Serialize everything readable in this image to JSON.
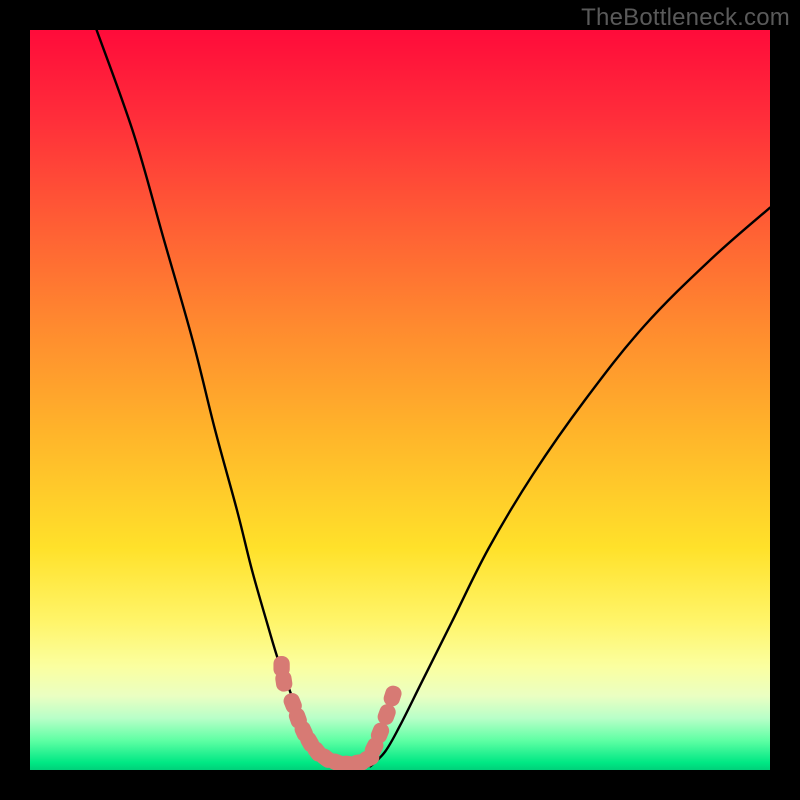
{
  "watermark": "TheBottleneck.com",
  "colors": {
    "frame": "#000000",
    "curve_stroke": "#000000",
    "marker_fill": "#d77a74",
    "marker_stroke": "#d77a74"
  },
  "chart_data": {
    "type": "line",
    "title": "",
    "xlabel": "",
    "ylabel": "",
    "xlim": [
      0,
      100
    ],
    "ylim": [
      0,
      100
    ],
    "grid": false,
    "legend": false,
    "series": [
      {
        "name": "left-curve",
        "x": [
          9,
          14,
          18,
          22,
          25,
          28,
          30,
          32,
          33.5,
          35,
          36.5,
          38,
          40,
          43
        ],
        "y": [
          100,
          86,
          72,
          58,
          46,
          35,
          27,
          20,
          15,
          11,
          7,
          4.5,
          2,
          0.5
        ]
      },
      {
        "name": "right-curve",
        "x": [
          46,
          48,
          50,
          53,
          57,
          62,
          68,
          75,
          83,
          92,
          100
        ],
        "y": [
          0.5,
          2.5,
          6,
          12,
          20,
          30,
          40,
          50,
          60,
          69,
          76
        ]
      },
      {
        "name": "markers",
        "x": [
          34.0,
          34.3,
          35.5,
          36.2,
          37.0,
          37.8,
          38.8,
          40.0,
          41.5,
          43.0,
          44.5,
          45.8,
          46.5,
          47.3,
          48.2,
          49.0
        ],
        "y": [
          14.0,
          12.0,
          9.0,
          7.0,
          5.2,
          3.8,
          2.5,
          1.6,
          1.0,
          0.8,
          1.0,
          1.6,
          3.0,
          5.0,
          7.5,
          10.0
        ]
      }
    ],
    "marker_radius_px": 9
  }
}
